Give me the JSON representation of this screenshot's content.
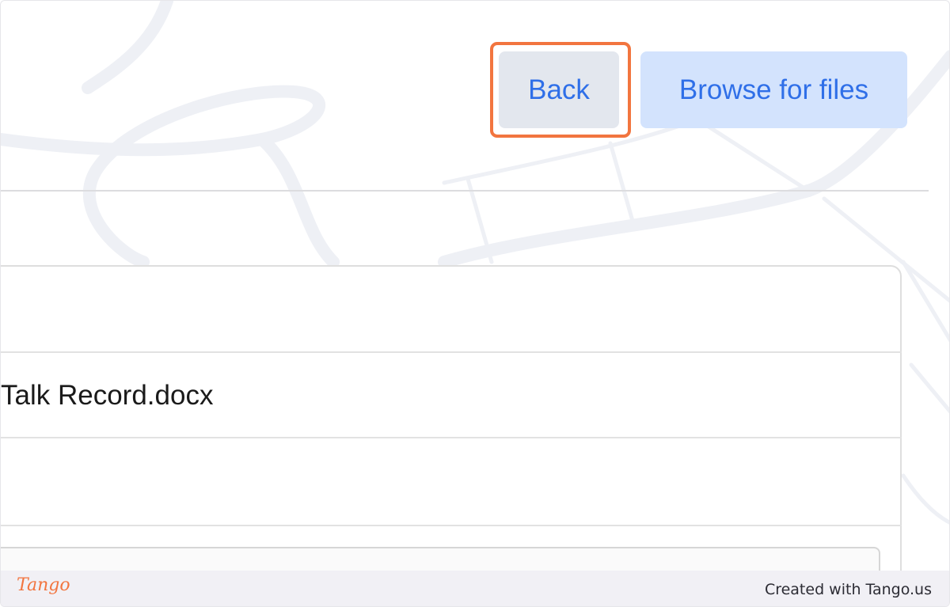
{
  "toolbar": {
    "back_label": "Back",
    "browse_label": "Browse for files"
  },
  "file_list": {
    "items": [
      "Talk Record.docx"
    ]
  },
  "footer": {
    "logo_text": "Tango",
    "credit_text": "Created with Tango.us"
  },
  "colors": {
    "accent": "#2f6fe8",
    "highlight": "#f2753f",
    "browse_bg": "#d3e3fd",
    "back_bg": "#e3e7ee"
  }
}
